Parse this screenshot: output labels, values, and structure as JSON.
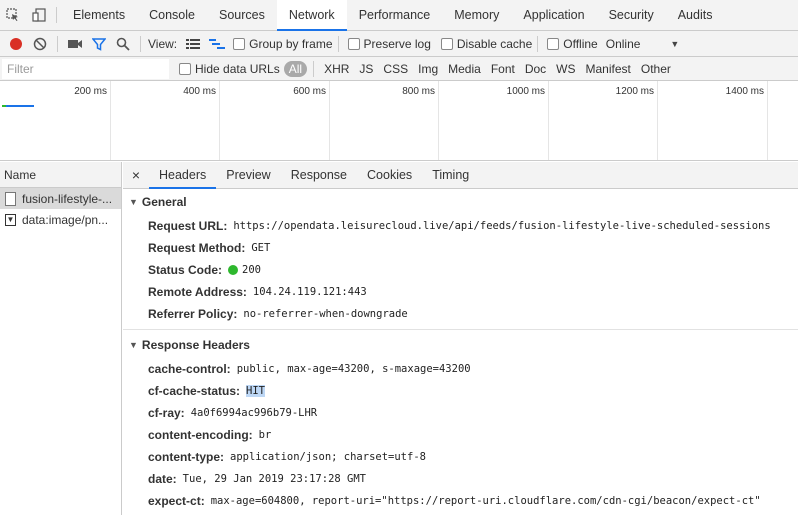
{
  "tabs": [
    {
      "label": "Elements"
    },
    {
      "label": "Console"
    },
    {
      "label": "Sources"
    },
    {
      "label": "Network"
    },
    {
      "label": "Performance"
    },
    {
      "label": "Memory"
    },
    {
      "label": "Application"
    },
    {
      "label": "Security"
    },
    {
      "label": "Audits"
    }
  ],
  "toolbar": {
    "view_label": "View:",
    "group_by_frame": "Group by frame",
    "preserve_log": "Preserve log",
    "disable_cache": "Disable cache",
    "offline": "Offline",
    "throttle": "Online",
    "record_color": "#d93025",
    "filter_color": "#1a73e8"
  },
  "filter": {
    "placeholder": "Filter",
    "hide_data_urls": "Hide data URLs",
    "types": [
      "All",
      "XHR",
      "JS",
      "CSS",
      "Img",
      "Media",
      "Font",
      "Doc",
      "WS",
      "Manifest",
      "Other"
    ]
  },
  "timeline": {
    "ticks": [
      "200 ms",
      "400 ms",
      "600 ms",
      "800 ms",
      "1000 ms",
      "1200 ms",
      "1400 ms"
    ]
  },
  "requests": {
    "header": "Name",
    "items": [
      {
        "name": "fusion-lifestyle-..."
      },
      {
        "name": "data:image/pn..."
      }
    ]
  },
  "detail": {
    "close": "×",
    "tabs": [
      {
        "label": "Headers"
      },
      {
        "label": "Preview"
      },
      {
        "label": "Response"
      },
      {
        "label": "Cookies"
      },
      {
        "label": "Timing"
      }
    ],
    "general": {
      "title": "General",
      "rows": [
        {
          "key": "Request URL:",
          "value": "https://opendata.leisurecloud.live/api/feeds/fusion-lifestyle-live-scheduled-sessions"
        },
        {
          "key": "Request Method:",
          "value": "GET"
        },
        {
          "key": "Status Code:",
          "value": "200"
        },
        {
          "key": "Remote Address:",
          "value": "104.24.119.121:443"
        },
        {
          "key": "Referrer Policy:",
          "value": "no-referrer-when-downgrade"
        }
      ]
    },
    "response_headers": {
      "title": "Response Headers",
      "rows": [
        {
          "key": "cache-control:",
          "value": "public, max-age=43200, s-maxage=43200"
        },
        {
          "key": "cf-cache-status:",
          "value": "HIT"
        },
        {
          "key": "cf-ray:",
          "value": "4a0f6994ac996b79-LHR"
        },
        {
          "key": "content-encoding:",
          "value": "br"
        },
        {
          "key": "content-type:",
          "value": "application/json; charset=utf-8"
        },
        {
          "key": "date:",
          "value": "Tue, 29 Jan 2019 23:17:28 GMT"
        },
        {
          "key": "expect-ct:",
          "value": "max-age=604800, report-uri=\"https://report-uri.cloudflare.com/cdn-cgi/beacon/expect-ct\""
        }
      ]
    },
    "status_color": "#2eb82e"
  }
}
